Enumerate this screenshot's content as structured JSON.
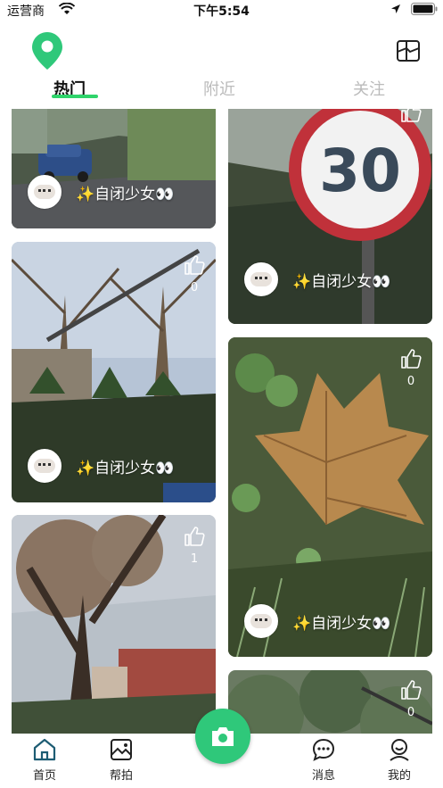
{
  "status_bar": {
    "carrier": "运营商",
    "time": "下午5:54"
  },
  "tabs": [
    {
      "label": "热门",
      "active": true
    },
    {
      "label": "附近",
      "active": false
    },
    {
      "label": "关注",
      "active": false
    }
  ],
  "feed": [
    {
      "author": "✨自闭少女👀"
    },
    {
      "author": "✨自闭少女👀",
      "likes": "0"
    },
    {
      "author": "✨自闭少女👀",
      "likes": "0"
    },
    {
      "author": "✨自闭少女👀"
    },
    {
      "author": "✨自闭少女👀",
      "likes": "0"
    },
    {
      "author": null,
      "likes": "1"
    },
    {
      "author": null,
      "likes": "0"
    }
  ],
  "bottom_nav": {
    "home": "首页",
    "help_photo": "帮拍",
    "messages": "消息",
    "mine": "我的"
  },
  "colors": {
    "accent": "#2fd46b",
    "camera": "#2fc87a",
    "tab_inactive": "#bbbbbb"
  },
  "icons": [
    "wifi-icon",
    "location-arrow-icon",
    "battery-icon",
    "map-pin-logo",
    "map-icon",
    "thumbs-up-icon",
    "home-icon",
    "photo-icon",
    "camera-icon",
    "message-icon",
    "profile-icon"
  ]
}
